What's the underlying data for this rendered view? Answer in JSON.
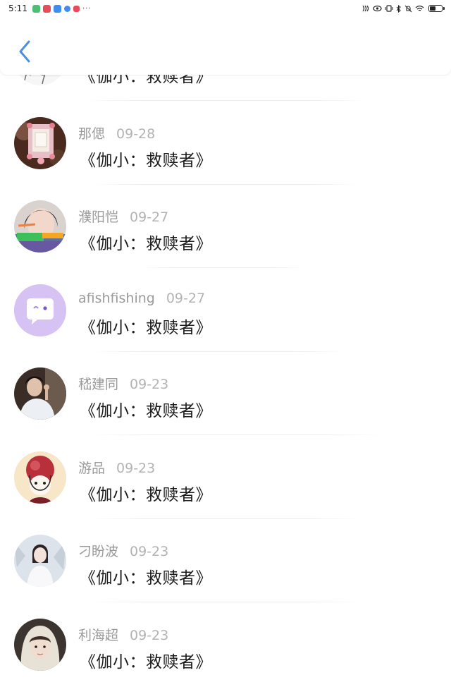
{
  "status_bar": {
    "time": "5:11",
    "more": "···",
    "app_colors": [
      "#4cbf72",
      "#e84c5a",
      "#3d8ef0",
      "#3d8ef0",
      "#e84c5a"
    ],
    "battery_level": 0.55
  },
  "header": {
    "back_icon": "chevron-left-icon",
    "accent": "#4a90e2"
  },
  "comments": [
    {
      "user": "",
      "date": "",
      "text": "《伽小：救赎者》",
      "avatar": "sketch-portrait",
      "partial": true
    },
    {
      "user": "那偲",
      "date": "09-28",
      "text": "《伽小：救赎者》",
      "avatar": "floral-frame"
    },
    {
      "user": "濮阳恺",
      "date": "09-27",
      "text": "《伽小：救赎者》",
      "avatar": "girl-portrait"
    },
    {
      "user": "afishfishing",
      "date": "09-27",
      "text": "《伽小：救赎者》",
      "avatar": "chat-bubble"
    },
    {
      "user": "嵇建同",
      "date": "09-23",
      "text": "《伽小：救赎者》",
      "avatar": "man-portrait"
    },
    {
      "user": "游品",
      "date": "09-23",
      "text": "《伽小：救赎者》",
      "avatar": "cartoon-girl"
    },
    {
      "user": "刁盼波",
      "date": "09-23",
      "text": "《伽小：救赎者》",
      "avatar": "winter-girl"
    },
    {
      "user": "利海超",
      "date": "09-23",
      "text": "《伽小：救赎者》",
      "avatar": "hood-girl"
    }
  ]
}
